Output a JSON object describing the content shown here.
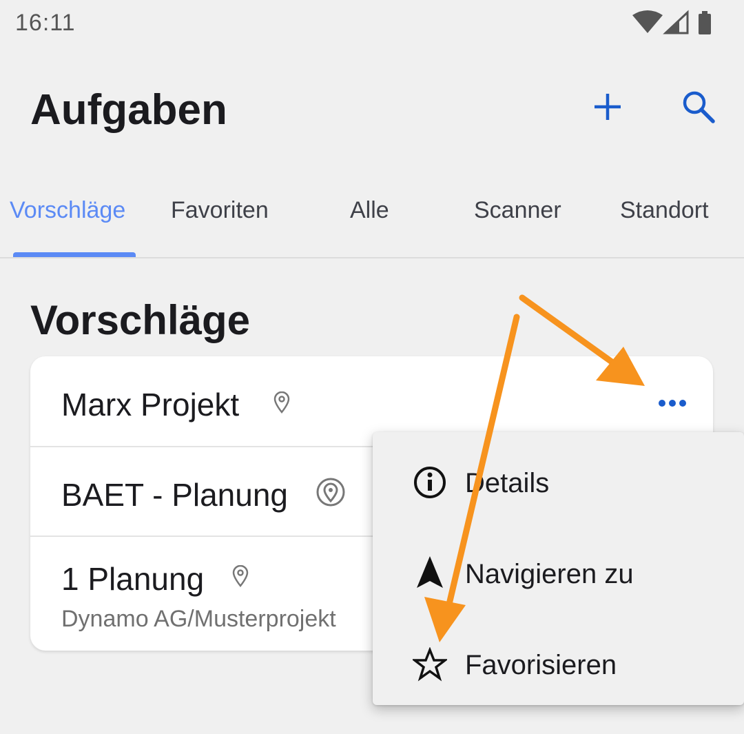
{
  "status_bar": {
    "time": "16:11"
  },
  "header": {
    "title": "Aufgaben",
    "add_icon": "plus-icon",
    "search_icon": "search-icon"
  },
  "tabs": [
    {
      "label": "Vorschläge",
      "active": true
    },
    {
      "label": "Favoriten",
      "active": false
    },
    {
      "label": "Alle",
      "active": false
    },
    {
      "label": "Scanner",
      "active": false
    },
    {
      "label": "Standort",
      "active": false
    }
  ],
  "section": {
    "title": "Vorschläge"
  },
  "tasks": [
    {
      "title": "Marx Projekt",
      "subtitle": ""
    },
    {
      "title": "BAET - Planung",
      "subtitle": ""
    },
    {
      "title": "1 Planung",
      "subtitle": "Dynamo AG/Musterprojekt"
    }
  ],
  "menu": {
    "items": [
      {
        "label": "Details",
        "icon": "info-icon"
      },
      {
        "label": "Navigieren zu",
        "icon": "navigation-arrow-icon"
      },
      {
        "label": "Favorisieren",
        "icon": "star-outline-icon"
      }
    ]
  },
  "colors": {
    "accent": "#5b8af5",
    "icon_blue": "#1a5ccc",
    "annotation_orange": "#f7931e",
    "background": "#f0f0f0"
  }
}
